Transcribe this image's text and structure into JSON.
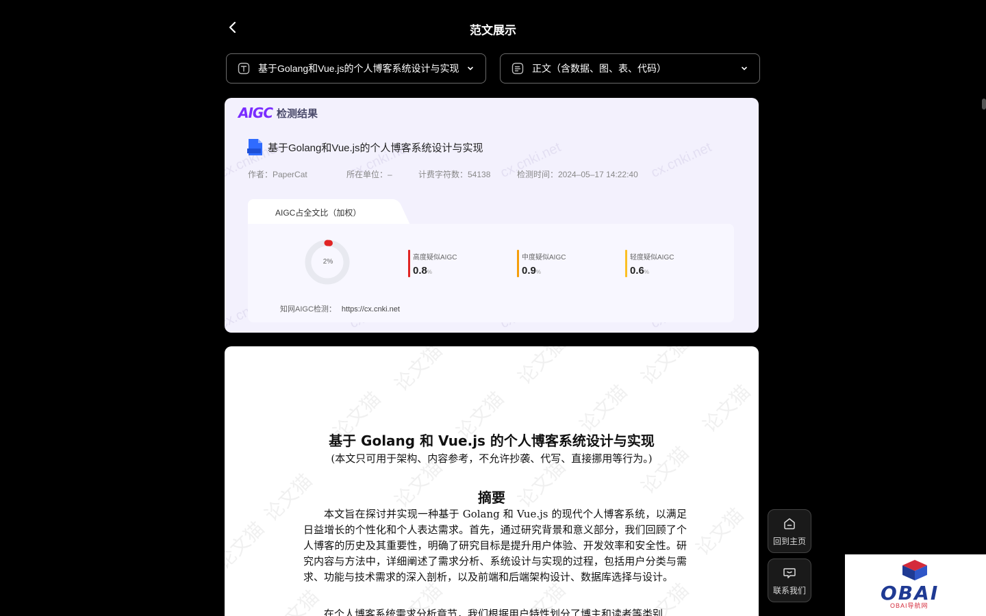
{
  "header": {
    "title": "范文展示"
  },
  "selects": {
    "title_value": "基于Golang和Vue.js的个人博客系统设计与实现",
    "section_value": "正文（含数据、图、表、代码）"
  },
  "result": {
    "logo": "AIGC",
    "heading": "检测结果",
    "doc_title": "基于Golang和Vue.js的个人博客系统设计与实现",
    "meta": {
      "author": "作者：PaperCat",
      "unit": "所在单位：–",
      "chars": "计费字符数：54138",
      "time": "检测时间：2024–05–17 14:22:40"
    },
    "tab_label": "AIGC占全文比（加权）",
    "overall_percent": "2%",
    "overall_fraction": 0.02,
    "metrics": [
      {
        "label": "高度疑似AIGC",
        "value": "0.8",
        "unit": "%",
        "color": "#e02424"
      },
      {
        "label": "中度疑似AIGC",
        "value": "0.9",
        "unit": "%",
        "color": "#f59e0b"
      },
      {
        "label": "轻度疑似AIGC",
        "value": "0.6",
        "unit": "%",
        "color": "#fbbf24"
      }
    ],
    "cnki_label": "知网AIGC检测：",
    "cnki_url": "https://cx.cnki.net",
    "watermark": "cx.cnki.net"
  },
  "paper": {
    "title": "基于 Golang 和 Vue.js 的个人博客系统设计与实现",
    "note": "(本文只可用于架构、内容参考，不允许抄袭、代写、直接挪用等行为。)",
    "abstract_heading": "摘要",
    "abstract_body": "本文旨在探讨并实现一种基于 Golang 和 Vue.js 的现代个人博客系统，以满足日益增长的个性化和个人表达需求。首先，通过研究背景和意义部分，我们回顾了个人博客的历史及其重要性，明确了研究目标是提升用户体验、开发效率和安全性。研究内容与方法中，详细阐述了需求分析、系统设计与实现的过程，包括用户分类与需求、功能与技术需求的深入剖析，以及前端和后端架构设计、数据库选择与设计。",
    "abstract_next": "在个人博客系统需求分析章节，我们根据用户特性划分了博主和读者等类别",
    "watermark": "论文猫"
  },
  "floating": {
    "home_label": "回到主页",
    "contact_label": "联系我们"
  },
  "brand": {
    "name": "OBAI",
    "sub": "OBAI导航网"
  }
}
